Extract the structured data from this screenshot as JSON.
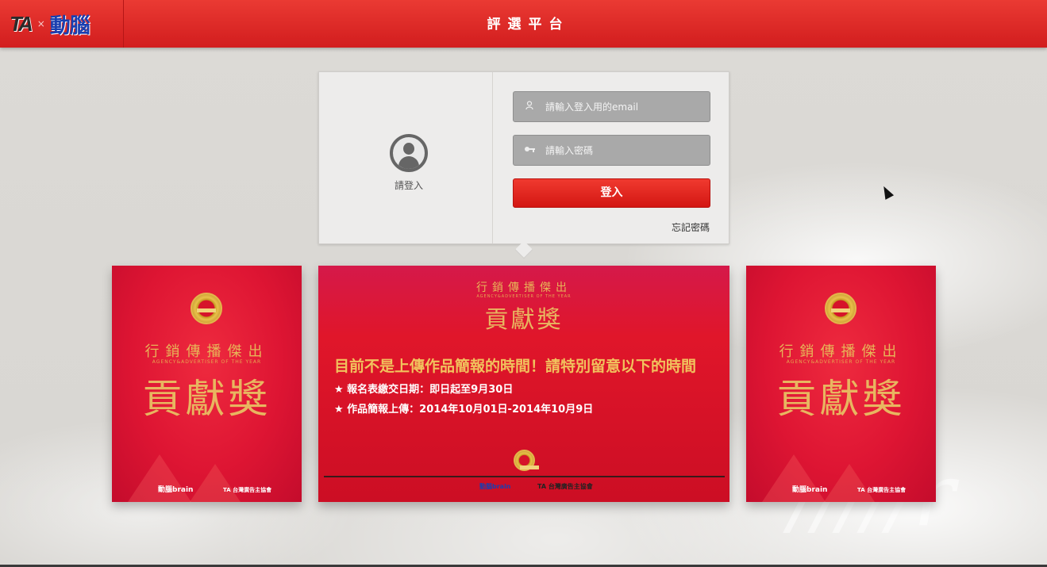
{
  "header": {
    "logo_ta": "TA",
    "logo_x": "×",
    "logo_brain": "動腦",
    "title": "評選平台"
  },
  "login": {
    "caption": "請登入",
    "email_placeholder": "請輸入登入用的email",
    "password_placeholder": "請輸入密碼",
    "submit_label": "登入",
    "forgot_label": "忘記密碼"
  },
  "side_card": {
    "subtitle": "行銷傳播傑出",
    "english": "AGENCY&ADVERTISER OF THE YEAR",
    "title": "貢獻獎",
    "brand_left": "動腦brain",
    "brand_right": "TA 台灣廣告主協會"
  },
  "center_card": {
    "subtitle": "行銷傳播傑出",
    "english": "AGENCY&ADVERTISER OF THE YEAR",
    "title": "貢獻獎",
    "notice": "目前不是上傳作品簡報的時間！請特別留意以下的時間",
    "line1": "★ 報名表繳交日期：即日起至9月30日",
    "line2": "★ 作品簡報上傳：2014年10月01日-2014年10月9日",
    "brand_left": "動腦brain",
    "brand_right": "TA 台灣廣告主協會"
  },
  "background": {
    "watermark": "/////r"
  },
  "colors": {
    "header_red": "#e02a28",
    "button_red": "#e12a21",
    "gold": "#e8b660",
    "brain_blue": "#1a3fb0"
  }
}
